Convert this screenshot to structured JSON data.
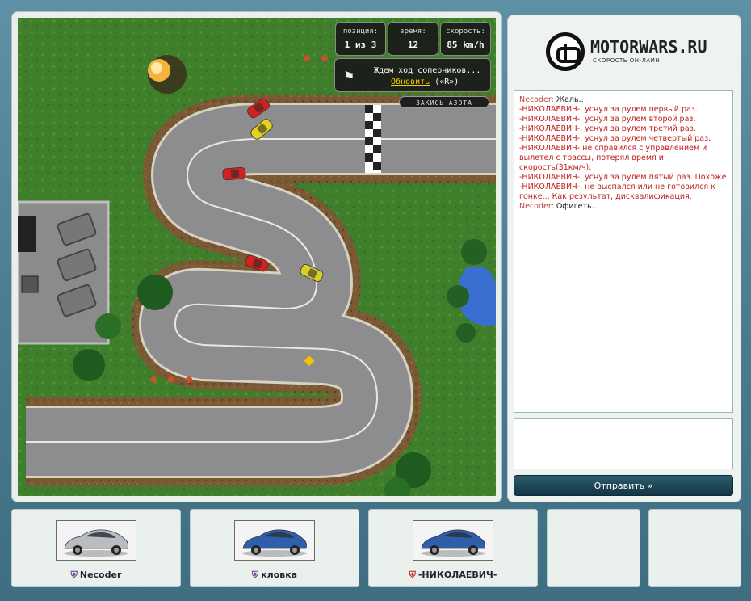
{
  "hud": {
    "position_label": "позиция:",
    "position_value": "1 из 3",
    "time_label": "время:",
    "time_value": "12",
    "speed_label": "скорость:",
    "speed_value": "85 km/h",
    "waiting_text": "Ждем ход соперников...",
    "refresh_link": "Обновить",
    "refresh_hotkey": "(«R»)",
    "nitro_button": "ЗАКИСЬ АЗОТА"
  },
  "logo": {
    "name": "MOTORWARS.RU",
    "tagline": "СКОРОСТЬ ОН-ЛАЙН"
  },
  "chat": {
    "messages": [
      {
        "nick": "Necoder:",
        "text": " Жаль..",
        "system": false
      },
      {
        "nick": "",
        "text": "-НИКОЛАЕВИЧ-, уснул за рулем первый раз.",
        "system": true
      },
      {
        "nick": "",
        "text": "-НИКОЛАЕВИЧ-, уснул за рулем второй раз.",
        "system": true
      },
      {
        "nick": "",
        "text": "-НИКОЛАЕВИЧ-, уснул за рулем третий раз.",
        "system": true
      },
      {
        "nick": "",
        "text": "-НИКОЛАЕВИЧ-, уснул за рулем четвертый раз.",
        "system": true
      },
      {
        "nick": "",
        "text": "-НИКОЛАЕВИЧ- не справился с управлением и вылетел с трассы, потерял время и скорость(31км/ч).",
        "system": true
      },
      {
        "nick": "",
        "text": "-НИКОЛАЕВИЧ-, уснул за рулем пятый раз. Похоже -НИКОЛАЕВИЧ-, не выспался или не готовился к гонке... Как результат, дисквалификация.",
        "system": true
      },
      {
        "nick": "Necoder:",
        "text": " Офигеть...",
        "system": false
      }
    ],
    "input_value": "",
    "send_label": "Отправить »"
  },
  "players": [
    {
      "name": "Necoder",
      "car_color": "#b9bcc0",
      "faction_color": "#6b3f8f"
    },
    {
      "name": "кловка",
      "car_color": "#2f5fa8",
      "faction_color": "#6b3f8f"
    },
    {
      "name": "-НИКОЛАЕВИЧ-",
      "car_color": "#2f5fa8",
      "faction_color": "#c0201d"
    },
    {
      "name": "",
      "car_color": "",
      "faction_color": ""
    },
    {
      "name": "",
      "car_color": "",
      "faction_color": ""
    }
  ],
  "colors": {
    "grass": "#3f7f2c",
    "asphalt": "#8d8d90",
    "dirt": "#7a5a34",
    "water": "#3a6fd1",
    "system_message": "#c0201d"
  },
  "track_cars": [
    {
      "color": "#d62020",
      "name": "red-car"
    },
    {
      "color": "#e6d21c",
      "name": "yellow-car"
    },
    {
      "color": "#d62020",
      "name": "red-car"
    },
    {
      "color": "#d62020",
      "name": "red-car"
    },
    {
      "color": "#d9cf2c",
      "name": "yellow-car"
    }
  ]
}
